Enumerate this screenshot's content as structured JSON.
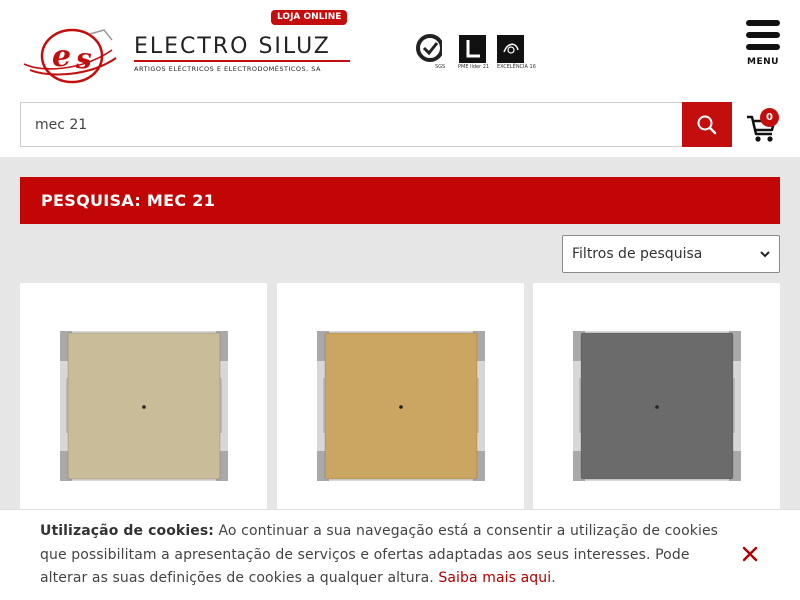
{
  "header": {
    "brand_name": "ELECTRO SILUZ",
    "brand_tagline": "ARTIGOS ELÉCTRICOS E ELECTRODOMÉSTICOS, SA",
    "store_badge": "LOJA ONLINE",
    "certifications": [
      {
        "icon": "sgs-certification-icon",
        "label": "SGS"
      },
      {
        "icon": "pme-lider-icon",
        "label": "PME líder 21"
      },
      {
        "icon": "pme-excelencia-icon",
        "label": "EXCELÊNCIA 16"
      }
    ],
    "menu_label": "MENU",
    "cart_count": "0"
  },
  "search": {
    "value": "mec 21",
    "placeholder": ""
  },
  "page": {
    "title": "PESQUISA: MEC 21",
    "filter_label": "Filtros de pesquisa"
  },
  "products": [
    {
      "name": "",
      "face_color": "#c9bc98",
      "frame_color": "#a9a9a9"
    },
    {
      "name": "",
      "face_color": "#cba662",
      "frame_color": "#a9a9a9"
    },
    {
      "name": "",
      "face_color": "#6b6b6b",
      "frame_color": "#a9a9a9"
    }
  ],
  "cookie": {
    "heading": "Utilização de cookies:",
    "body": " Ao continuar a sua navegação está a consentir a utilização de cookies que possibilitam a apresentação de serviços e ofertas adaptadas aos seus interesses. Pode alterar as suas definições de cookies a qualquer altura. ",
    "link_text": "Saiba mais aqui",
    "trailing": "."
  },
  "colors": {
    "accent": "#c40d0d",
    "title_bar": "#c20606",
    "page_bg": "#e6e6e6"
  }
}
